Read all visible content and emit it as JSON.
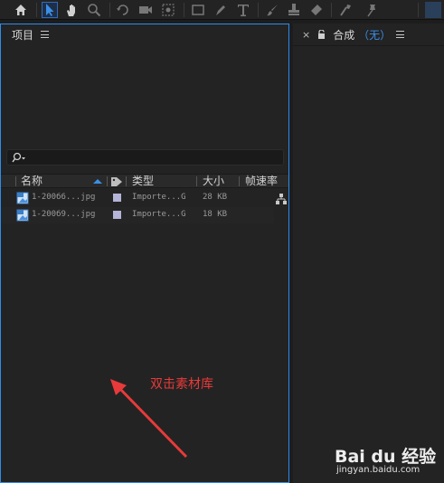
{
  "toolbar": {
    "tools": [
      "home-icon",
      "selection-tool-icon",
      "hand-tool-icon",
      "zoom-tool-icon",
      "rotate-tool-icon",
      "camera-tool-icon",
      "pan-behind-tool-icon",
      "rectangle-tool-icon",
      "pen-tool-icon",
      "type-tool-icon",
      "brush-tool-icon",
      "clone-stamp-tool-icon",
      "eraser-tool-icon",
      "roto-brush-tool-icon",
      "puppet-pin-tool-icon"
    ]
  },
  "project": {
    "title": "项目",
    "search": {
      "value": "",
      "placeholder": ""
    },
    "columns": {
      "name": "名称",
      "type": "类型",
      "size": "大小",
      "framerate": "帧速率"
    },
    "files": [
      {
        "name": "1-200б6...jpg",
        "type": "Importe...G",
        "size": "28 KB"
      },
      {
        "name": "1-200б9...jpg",
        "type": "Importe...G",
        "size": "18 KB"
      }
    ]
  },
  "annotation": {
    "text": "双击素材库",
    "color": "#e83a3a"
  },
  "composition": {
    "close": "×",
    "title_prefix": "合成",
    "title_value": "（无）"
  },
  "watermark": {
    "brand": "Bai du 经验",
    "url": "jingyan.baidu.com"
  },
  "colors": {
    "accent": "#2d8ceb",
    "panel": "#232323",
    "background": "#1d1d1d"
  }
}
